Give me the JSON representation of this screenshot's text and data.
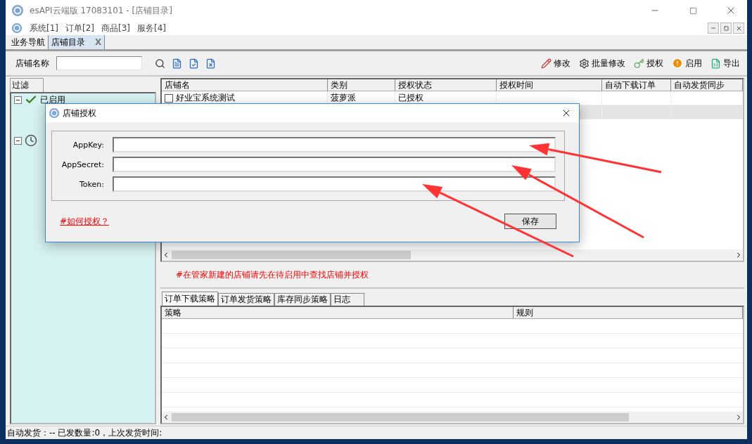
{
  "window": {
    "title": "esAPI云端版 17083101 - [店铺目录]"
  },
  "menu": [
    {
      "label": "系统[1]"
    },
    {
      "label": "订单[2]"
    },
    {
      "label": "商品[3]"
    },
    {
      "label": "服务[4]"
    }
  ],
  "doc_tabs": [
    {
      "label": "业务导航",
      "selected": false
    },
    {
      "label": "店铺目录",
      "selected": true,
      "close": "X"
    }
  ],
  "toolbar": {
    "search_label": "店铺名称",
    "actions": [
      {
        "kind": "edit",
        "label": "修改"
      },
      {
        "kind": "batch",
        "label": "批量修改"
      },
      {
        "kind": "key",
        "label": "授权"
      },
      {
        "kind": "warning",
        "label": "启用"
      },
      {
        "kind": "export",
        "label": "导出"
      }
    ]
  },
  "filter": {
    "tab": "过滤",
    "tree": [
      {
        "kind": "check",
        "label": "已启用",
        "expanded": true
      },
      {
        "kind": "clock",
        "expanded": true
      }
    ]
  },
  "table": {
    "columns": [
      "店铺名",
      "类别",
      "授权状态",
      "授权时间",
      "自动下载订单",
      "自动发货同步"
    ],
    "rows": [
      {
        "checked": false,
        "selected": false,
        "cells": [
          "好业宝系统测试",
          "菠萝派",
          "已授权"
        ]
      },
      {
        "selected": true,
        "cells": []
      }
    ]
  },
  "notice": "#在管家新建的店铺请先在待启用中查找店铺并授权",
  "detail_tabs": [
    {
      "label": "订单下载策略",
      "selected": true
    },
    {
      "label": "订单发货策略",
      "selected": false
    },
    {
      "label": "库存同步策略",
      "selected": false
    },
    {
      "label": "日志",
      "selected": false
    }
  ],
  "detail_table": {
    "columns": [
      "策略",
      "规则"
    ]
  },
  "status_bar": "自动发货：-- 已发数量:0，上次发货时间:",
  "dialog": {
    "title": "店铺授权",
    "fields": [
      {
        "label": "AppKey:"
      },
      {
        "label": "AppSecret:"
      },
      {
        "label": "Token:"
      }
    ],
    "link": "#如何授权？",
    "button": "保存"
  }
}
